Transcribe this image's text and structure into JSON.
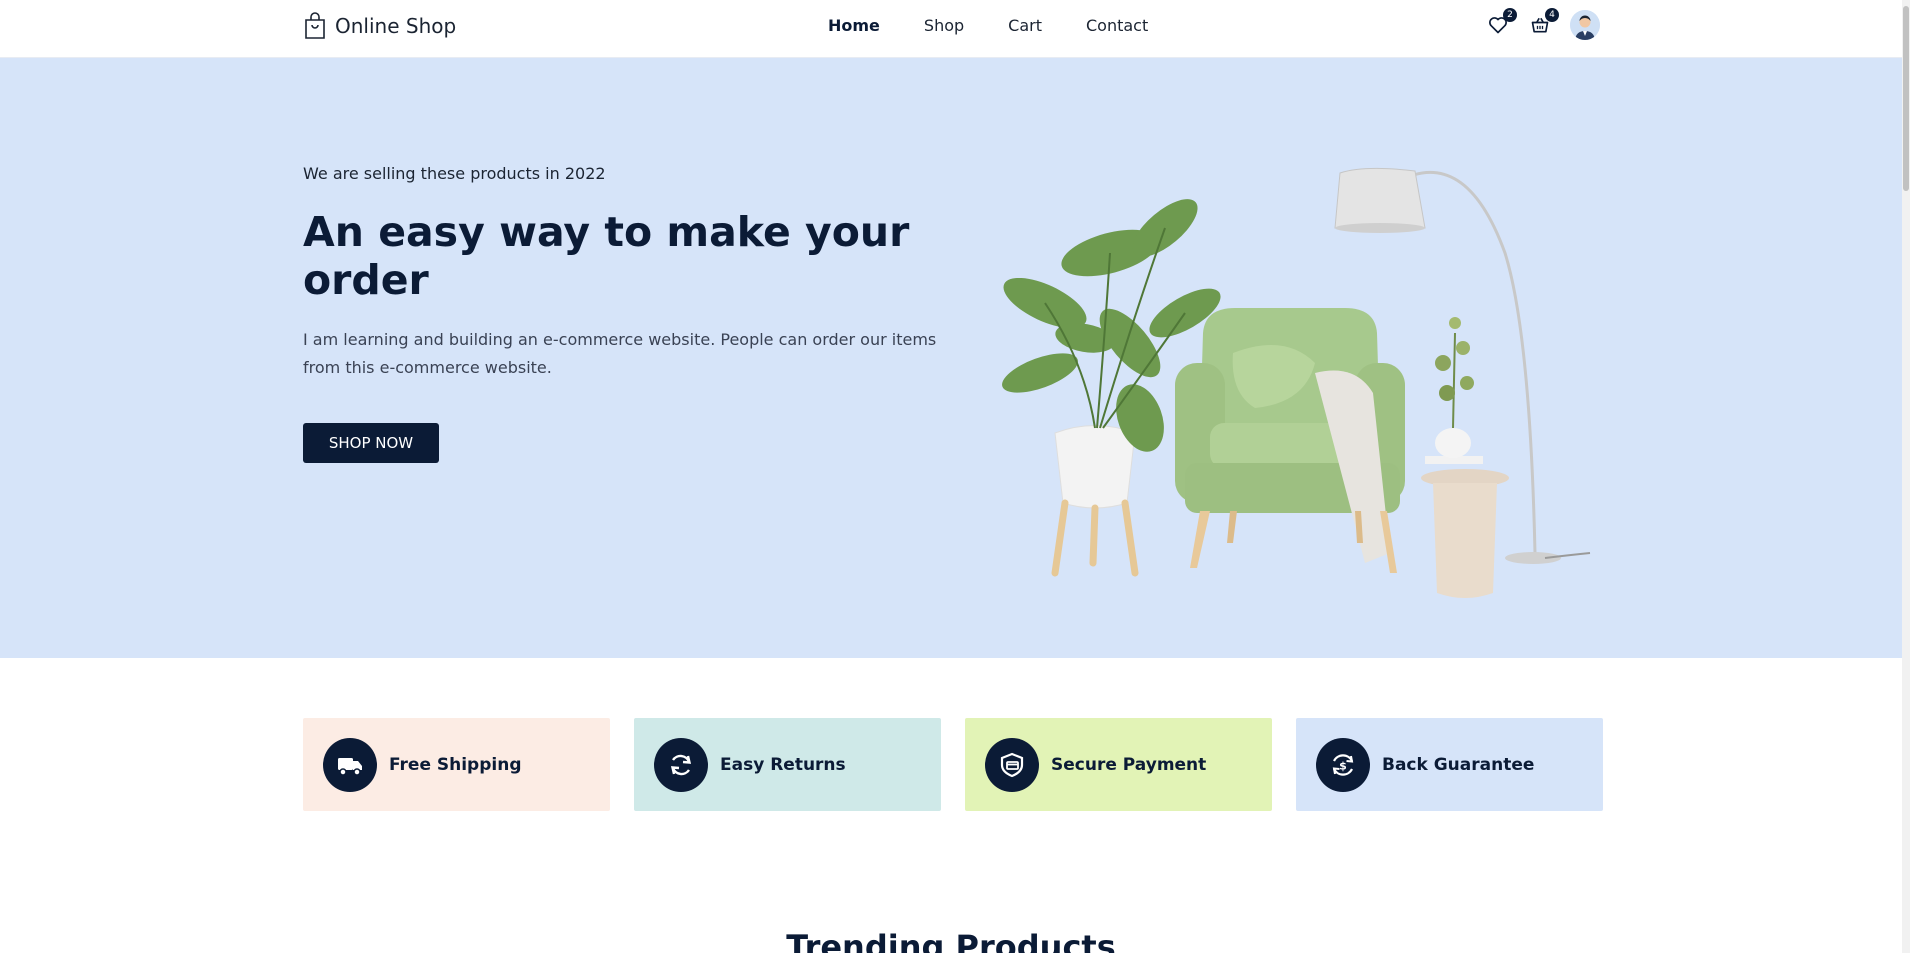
{
  "header": {
    "brand_name": "Online Shop",
    "nav": [
      {
        "label": "Home",
        "active": true
      },
      {
        "label": "Shop",
        "active": false
      },
      {
        "label": "Cart",
        "active": false
      },
      {
        "label": "Contact",
        "active": false
      }
    ],
    "wishlist_count": "2",
    "cart_count": "4",
    "icons": [
      "shopping-bag-icon",
      "heart-icon",
      "basket-icon",
      "avatar"
    ]
  },
  "hero": {
    "subtitle": "We are selling these products in 2022",
    "title": "An easy way to make your order",
    "description": "I am learning and building an e-commerce website. People can order our items from this e-commerce website.",
    "cta_label": "SHOP NOW",
    "background": "#d6e4f9"
  },
  "features": [
    {
      "label": "Free Shipping",
      "icon": "truck-icon",
      "color": "#fcece4"
    },
    {
      "label": "Easy Returns",
      "icon": "refresh-icon",
      "color": "#cfe9e8"
    },
    {
      "label": "Secure Payment",
      "icon": "shield-card-icon",
      "color": "#e2f3b6"
    },
    {
      "label": "Back Guarantee",
      "icon": "money-back-icon",
      "color": "#d6e4f9"
    }
  ],
  "trending": {
    "title": "Trending Products"
  },
  "colors": {
    "primary": "#0b1b36",
    "text": "#1b2432"
  }
}
